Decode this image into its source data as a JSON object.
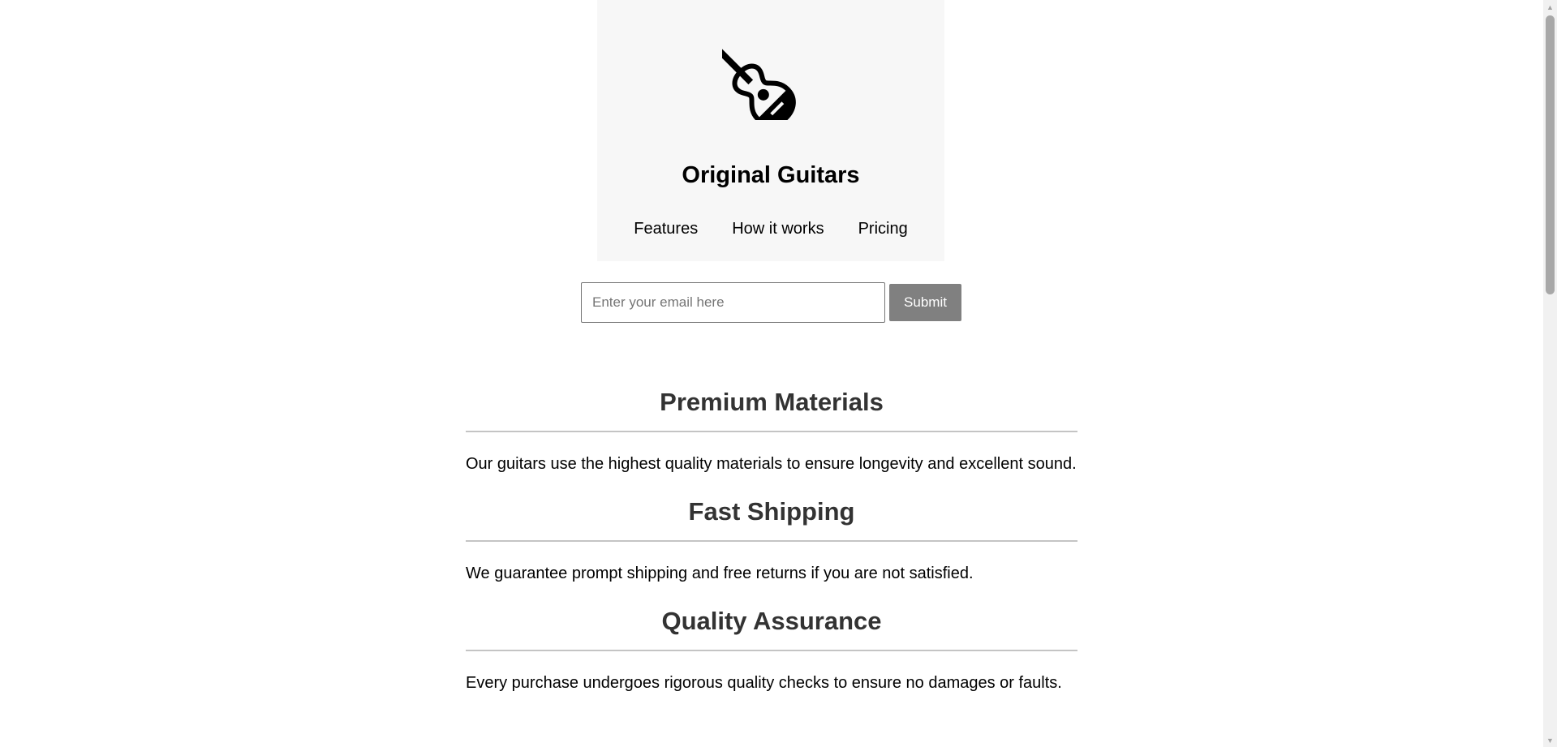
{
  "header": {
    "logo_icon": "guitar-icon",
    "title": "Original Guitars",
    "nav": [
      {
        "label": "Features"
      },
      {
        "label": "How it works"
      },
      {
        "label": "Pricing"
      }
    ]
  },
  "form": {
    "email_placeholder": "Enter your email here",
    "email_value": "",
    "submit_label": "Submit"
  },
  "features": [
    {
      "title": "Premium Materials",
      "text": "Our guitars use the highest quality materials to ensure longevity and excellent sound."
    },
    {
      "title": "Fast Shipping",
      "text": "We guarantee prompt shipping and free returns if you are not satisfied."
    },
    {
      "title": "Quality Assurance",
      "text": "Every purchase undergoes rigorous quality checks to ensure no damages or faults."
    }
  ],
  "scrollbar": {
    "up_icon": "scroll-up-arrow-icon",
    "down_icon": "scroll-down-arrow-icon",
    "scroll_fraction": 0.0
  }
}
